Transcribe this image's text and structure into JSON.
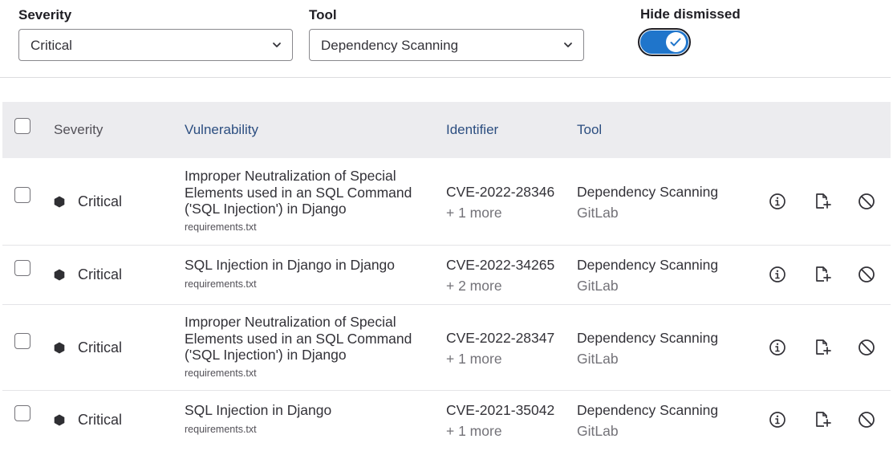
{
  "filters": {
    "severity": {
      "label": "Severity",
      "value": "Critical"
    },
    "tool": {
      "label": "Tool",
      "value": "Dependency Scanning"
    },
    "hide_dismissed": {
      "label": "Hide dismissed",
      "enabled": true
    }
  },
  "table": {
    "headers": {
      "severity": "Severity",
      "vulnerability": "Vulnerability",
      "identifier": "Identifier",
      "tool": "Tool"
    },
    "rows": [
      {
        "severity": "Critical",
        "title": "Improper Neutralization of Special Elements used in an SQL Command ('SQL Injection') in Django",
        "file": "requirements.txt",
        "identifier": "CVE-2022-28346",
        "more": "+ 1 more",
        "tool": "Dependency Scanning",
        "vendor": "GitLab"
      },
      {
        "severity": "Critical",
        "title": "SQL Injection in Django in Django",
        "file": "requirements.txt",
        "identifier": "CVE-2022-34265",
        "more": "+ 2 more",
        "tool": "Dependency Scanning",
        "vendor": "GitLab"
      },
      {
        "severity": "Critical",
        "title": "Improper Neutralization of Special Elements used in an SQL Command ('SQL Injection') in Django",
        "file": "requirements.txt",
        "identifier": "CVE-2022-28347",
        "more": "+ 1 more",
        "tool": "Dependency Scanning",
        "vendor": "GitLab"
      },
      {
        "severity": "Critical",
        "title": "SQL Injection in Django",
        "file": "requirements.txt",
        "identifier": "CVE-2021-35042",
        "more": "+ 1 more",
        "tool": "Dependency Scanning",
        "vendor": "GitLab"
      }
    ]
  },
  "icons": {
    "severity": "severity-critical-icon",
    "details": "information-icon",
    "issue": "create-issue-icon",
    "dismiss": "dismiss-icon",
    "dropdown": "chevron-down-icon",
    "toggle_check": "check-icon"
  },
  "colors": {
    "toggle_on": "#1f75cb",
    "header_bg": "#ececef",
    "severity_critical": "#2f2f33"
  }
}
